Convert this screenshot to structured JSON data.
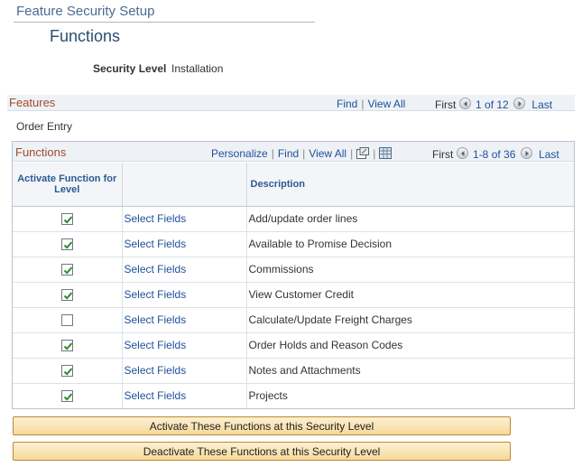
{
  "page": {
    "title": "Feature Security Setup",
    "subtitle": "Functions"
  },
  "security": {
    "label": "Security Level",
    "value": "Installation"
  },
  "features": {
    "title": "Features",
    "find": "Find",
    "view_all": "View All",
    "first": "First",
    "range": "1 of 12",
    "last": "Last",
    "current": "Order Entry"
  },
  "functions": {
    "title": "Functions",
    "personalize": "Personalize",
    "find": "Find",
    "view_all": "View All",
    "first": "First",
    "range": "1-8 of 36",
    "last": "Last",
    "columns": {
      "activate": "Activate Function for Level",
      "fields": "",
      "description": "Description"
    },
    "rows": [
      {
        "checked": true,
        "link": "Select Fields",
        "description": "Add/update order lines"
      },
      {
        "checked": true,
        "link": "Select Fields",
        "description": "Available to Promise Decision"
      },
      {
        "checked": true,
        "link": "Select Fields",
        "description": "Commissions"
      },
      {
        "checked": true,
        "link": "Select Fields",
        "description": "View Customer Credit"
      },
      {
        "checked": false,
        "link": "Select Fields",
        "description": "Calculate/Update Freight Charges"
      },
      {
        "checked": true,
        "link": "Select Fields",
        "description": "Order Holds and Reason Codes"
      },
      {
        "checked": true,
        "link": "Select Fields",
        "description": "Notes and Attachments"
      },
      {
        "checked": true,
        "link": "Select Fields",
        "description": "Projects"
      }
    ]
  },
  "buttons": {
    "activate": "Activate These Functions at this Security Level",
    "deactivate": "Deactivate These Functions at this Security Level"
  },
  "icons": {
    "prev": "chevron-left-icon",
    "next": "chevron-right-icon",
    "zoom": "new-window-icon",
    "download": "download-grid-icon",
    "check": "checkmark-icon"
  },
  "colors": {
    "link": "#1e4f9a",
    "grid_title": "#a14b2a",
    "checkmark": "#2e8b2e",
    "button_fill": "#f6d99a"
  }
}
